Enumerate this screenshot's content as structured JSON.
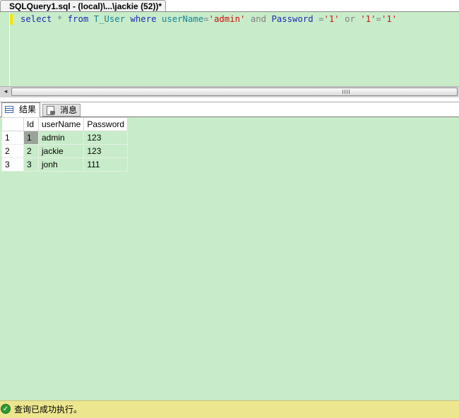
{
  "document_tab": {
    "title": "SQLQuery1.sql - (local)\\...\\jackie (52))*"
  },
  "editor": {
    "tokens": [
      {
        "text": "select",
        "cls": "kw"
      },
      {
        "text": " ",
        "cls": ""
      },
      {
        "text": "*",
        "cls": "op"
      },
      {
        "text": " ",
        "cls": ""
      },
      {
        "text": "from",
        "cls": "kw"
      },
      {
        "text": " ",
        "cls": ""
      },
      {
        "text": "T_User",
        "cls": "id"
      },
      {
        "text": " ",
        "cls": ""
      },
      {
        "text": "where",
        "cls": "kw"
      },
      {
        "text": " ",
        "cls": ""
      },
      {
        "text": "userName",
        "cls": "id"
      },
      {
        "text": "=",
        "cls": "op"
      },
      {
        "text": "'admin'",
        "cls": "str"
      },
      {
        "text": " ",
        "cls": ""
      },
      {
        "text": "and",
        "cls": "op"
      },
      {
        "text": " ",
        "cls": ""
      },
      {
        "text": "Password",
        "cls": "kw"
      },
      {
        "text": " ",
        "cls": ""
      },
      {
        "text": "=",
        "cls": "op"
      },
      {
        "text": "'1'",
        "cls": "str"
      },
      {
        "text": " ",
        "cls": ""
      },
      {
        "text": "or",
        "cls": "op"
      },
      {
        "text": " ",
        "cls": ""
      },
      {
        "text": "'1'",
        "cls": "str"
      },
      {
        "text": "=",
        "cls": "op"
      },
      {
        "text": "'1'",
        "cls": "str"
      }
    ]
  },
  "scrollbar": {
    "left_arrow": "◂",
    "grip": "⦀"
  },
  "result_tabs": [
    {
      "label": "结果",
      "icon": "grid-icon",
      "active": true
    },
    {
      "label": "消息",
      "icon": "message-icon",
      "active": false
    }
  ],
  "results": {
    "columns": [
      "Id",
      "userName",
      "Password"
    ],
    "rows": [
      {
        "rownum": "1",
        "cells": [
          "1",
          "admin",
          "123"
        ]
      },
      {
        "rownum": "2",
        "cells": [
          "2",
          "jackie",
          "123"
        ]
      },
      {
        "rownum": "3",
        "cells": [
          "3",
          "jonh",
          "111"
        ]
      }
    ],
    "selected_cell": {
      "row": 0,
      "col": 0
    }
  },
  "status": {
    "text": "查询已成功执行。",
    "icon": "success-check-icon",
    "icon_glyph": "✓"
  }
}
